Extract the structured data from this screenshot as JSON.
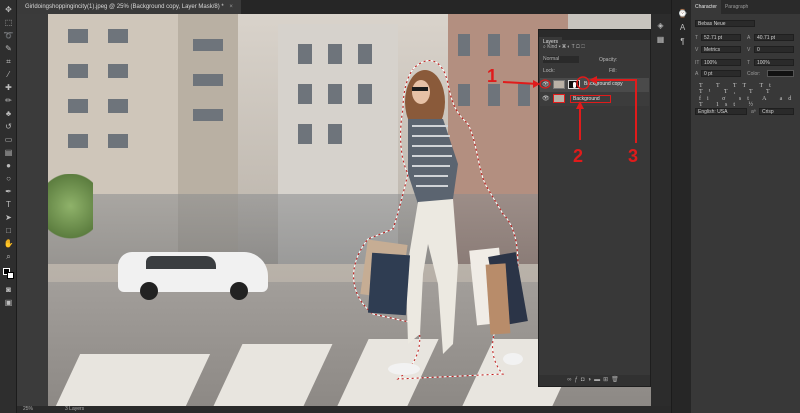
{
  "document": {
    "tab_title": "Girldoingshoppingincity(1).jpeg @ 25% (Background copy, Layer Mask/8) *",
    "zoom": "25%",
    "status": "3 Layers"
  },
  "layers_panel": {
    "tab": "Layers",
    "kind_label": "Kind",
    "blend_mode": "Normal",
    "opacity_label": "Opacity:",
    "lock_label": "Lock:",
    "fill_label": "Fill:",
    "layers": [
      {
        "name": "Background copy",
        "has_mask": true,
        "visible": true
      },
      {
        "name": "Background",
        "has_mask": false,
        "visible": true
      }
    ]
  },
  "annotations": {
    "num1": "1",
    "num2": "2",
    "num3": "3",
    "color": "#e01b1b"
  },
  "character_panel": {
    "tab_character": "Character",
    "tab_paragraph": "Paragraph",
    "font_family": "Bebas Neue",
    "font_size": "52.71 pt",
    "leading": "40.71 pt",
    "kerning": "Metrics",
    "tracking": "0",
    "vertical_scale": "100%",
    "horizontal_scale": "100%",
    "baseline_shift": "0 pt",
    "color_label": "Color:",
    "language": "English: USA",
    "antialias": "Crisp",
    "aa_prefix": "aª"
  },
  "icons": {
    "eye": "eye-icon",
    "move": "move-tool-icon",
    "marquee": "marquee-tool-icon"
  }
}
